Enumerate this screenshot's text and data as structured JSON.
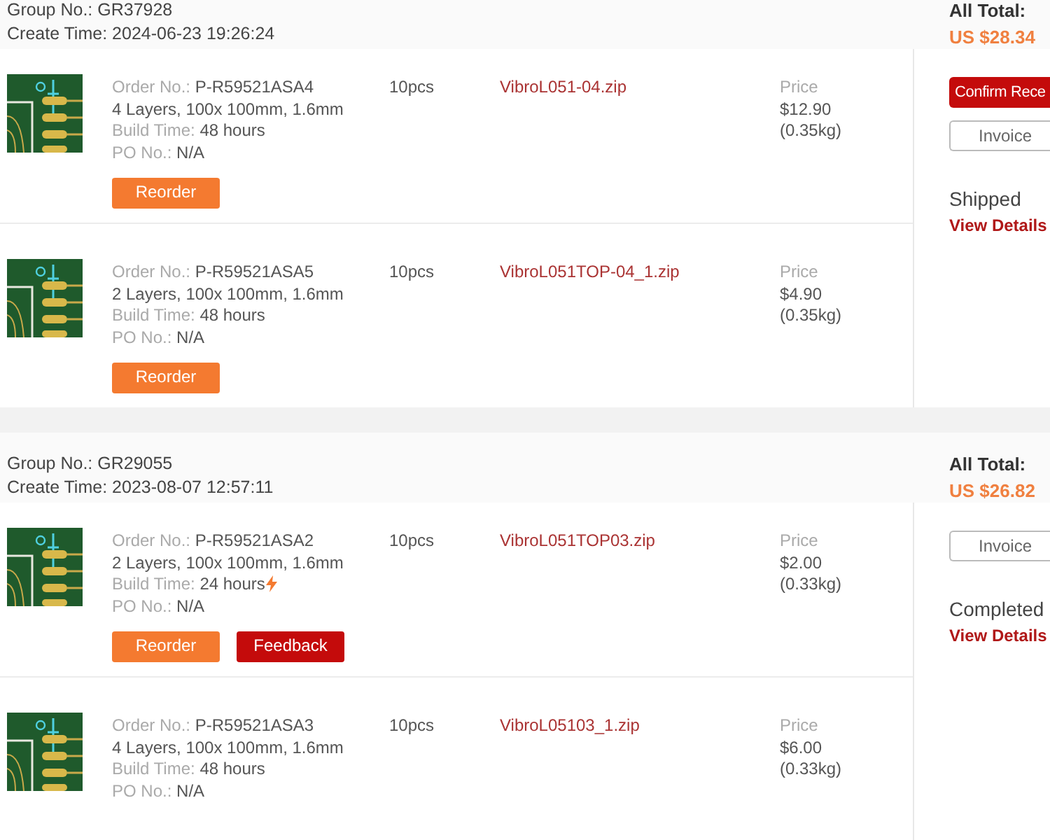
{
  "groups": [
    {
      "group_no": {
        "label": "Group No.:",
        "value": "GR37928"
      },
      "create_time": {
        "label": "Create Time:",
        "value": "2024-06-23 19:26:24"
      },
      "total_label": "All Total:",
      "total": "US $28.34",
      "actions": [
        {
          "label": "Confirm Rece",
          "kind": "primary"
        },
        {
          "label": "Invoice",
          "kind": "outline"
        }
      ],
      "status": "Shipped",
      "details_link": "View Details",
      "items": [
        {
          "order_no": {
            "label": "Order No.:",
            "value": "P-R59521ASA4"
          },
          "spec": "4 Layers, 100x 100mm, 1.6mm",
          "build_time": {
            "label": "Build Time:",
            "value": "48 hours",
            "expedited": false
          },
          "po_no": {
            "label": "PO No.:",
            "value": "N/A"
          },
          "quantity": "10pcs",
          "file": "VibroL051-04.zip",
          "price_label": "Price",
          "price": "$12.90",
          "weight": "(0.35kg)",
          "buttons": [
            {
              "label": "Reorder",
              "kind": "reorder"
            }
          ]
        },
        {
          "order_no": {
            "label": "Order No.:",
            "value": "P-R59521ASA5"
          },
          "spec": "2 Layers, 100x 100mm, 1.6mm",
          "build_time": {
            "label": "Build Time:",
            "value": "48 hours",
            "expedited": false
          },
          "po_no": {
            "label": "PO No.:",
            "value": "N/A"
          },
          "quantity": "10pcs",
          "file": "VibroL051TOP-04_1.zip",
          "price_label": "Price",
          "price": "$4.90",
          "weight": "(0.35kg)",
          "buttons": [
            {
              "label": "Reorder",
              "kind": "reorder"
            }
          ]
        }
      ]
    },
    {
      "group_no": {
        "label": "Group No.:",
        "value": "GR29055"
      },
      "create_time": {
        "label": "Create Time:",
        "value": "2023-08-07 12:57:11"
      },
      "total_label": "All Total:",
      "total": "US $26.82",
      "actions": [
        {
          "label": "Invoice",
          "kind": "outline"
        }
      ],
      "status": "Completed",
      "details_link": "View Details",
      "items": [
        {
          "order_no": {
            "label": "Order No.:",
            "value": "P-R59521ASA2"
          },
          "spec": "2 Layers, 100x 100mm, 1.6mm",
          "build_time": {
            "label": "Build Time:",
            "value": "24 hours",
            "expedited": true
          },
          "po_no": {
            "label": "PO No.:",
            "value": "N/A"
          },
          "quantity": "10pcs",
          "file": "VibroL051TOP03.zip",
          "price_label": "Price",
          "price": "$2.00",
          "weight": "(0.33kg)",
          "buttons": [
            {
              "label": "Reorder",
              "kind": "reorder"
            },
            {
              "label": "Feedback",
              "kind": "feedback"
            }
          ]
        },
        {
          "order_no": {
            "label": "Order No.:",
            "value": "P-R59521ASA3"
          },
          "spec": "4 Layers, 100x 100mm, 1.6mm",
          "build_time": {
            "label": "Build Time:",
            "value": "48 hours",
            "expedited": false
          },
          "po_no": {
            "label": "PO No.:",
            "value": "N/A"
          },
          "quantity": "10pcs",
          "file": "VibroL05103_1.zip",
          "price_label": "Price",
          "price": "$6.00",
          "weight": "(0.33kg)"
        }
      ]
    }
  ]
}
